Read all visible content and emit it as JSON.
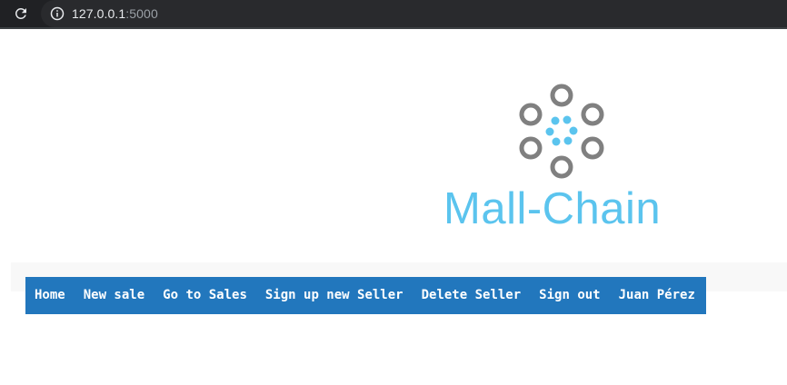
{
  "browser": {
    "url_host": "127.0.0.1",
    "url_port": ":5000",
    "reload_icon": "reload-icon",
    "info_icon": "info-icon"
  },
  "brand": {
    "name": "Mall-Chain",
    "logo_icon": "chain-circle-logo",
    "colors": {
      "accent": "#5bc4ee",
      "ring": "#808080",
      "nav": "#2277bd"
    }
  },
  "nav": {
    "items": [
      {
        "label": "Home"
      },
      {
        "label": "New sale"
      },
      {
        "label": "Go to Sales"
      },
      {
        "label": "Sign up new Seller"
      },
      {
        "label": "Delete Seller"
      },
      {
        "label": "Sign out"
      },
      {
        "label": "Juan Pérez"
      }
    ]
  }
}
